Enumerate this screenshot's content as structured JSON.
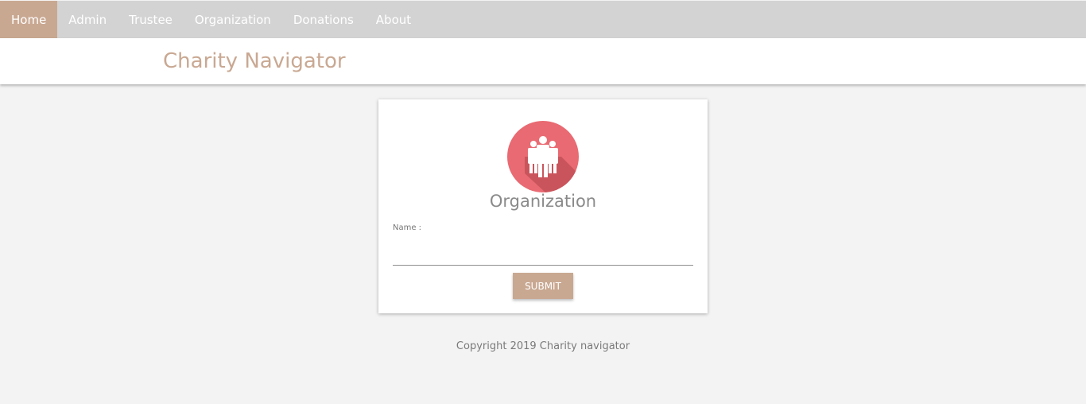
{
  "nav": {
    "items": [
      {
        "label": "Home",
        "active": true
      },
      {
        "label": "Admin",
        "active": false
      },
      {
        "label": "Trustee",
        "active": false
      },
      {
        "label": "Organization",
        "active": false
      },
      {
        "label": "Donations",
        "active": false
      },
      {
        "label": "About",
        "active": false
      }
    ]
  },
  "header": {
    "title": "Charity Navigator"
  },
  "card": {
    "icon": "group-people-icon",
    "title": "Organization",
    "name_label": "Name :",
    "name_value": "",
    "submit_label": "SUBMIT"
  },
  "footer": {
    "copyright": "Copyright 2019 Charity navigator"
  },
  "colors": {
    "accent": "#c9a892",
    "navbar_bg": "#d3d3d3",
    "logo_bg": "#e96a72",
    "page_bg": "#f3f3f3"
  }
}
